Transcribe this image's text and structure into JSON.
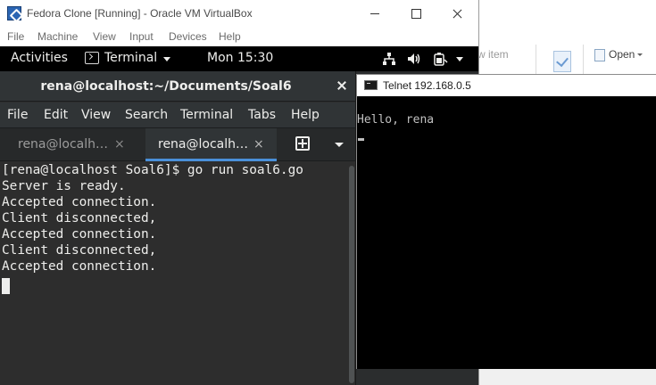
{
  "host_explorer": {
    "new_item_label": "w item",
    "open_label": "Open"
  },
  "vbox": {
    "title": "Fedora Clone [Running] - Oracle VM VirtualBox",
    "menu": [
      "File",
      "Machine",
      "View",
      "Input",
      "Devices",
      "Help"
    ]
  },
  "gnome": {
    "activities": "Activities",
    "app_name": "Terminal",
    "clock": "Mon 15:30",
    "icons": [
      "network-icon",
      "volume-icon",
      "battery-icon"
    ]
  },
  "terminal": {
    "title": "rena@localhost:~/Documents/Soal6",
    "menu": [
      "File",
      "Edit",
      "View",
      "Search",
      "Terminal",
      "Tabs",
      "Help"
    ],
    "tabs": [
      {
        "label": "rena@localh…",
        "active": false
      },
      {
        "label": "rena@localh…",
        "active": true
      }
    ],
    "tab_close_glyph": "×",
    "lines": [
      "[rena@localhost Soal6]$ go run soal6.go",
      "Server is ready.",
      "Accepted connection.",
      "Client disconnected,",
      "Accepted connection.",
      "Client disconnected,",
      "Accepted connection."
    ]
  },
  "telnet": {
    "title": "Telnet 192.168.0.5",
    "output": "Hello, rena"
  },
  "colors": {
    "gnome_topbar": "#000000",
    "terminal_bg": "#2d2d2d",
    "active_tab_accent": "#4a90d9",
    "telnet_bg": "#000000"
  }
}
